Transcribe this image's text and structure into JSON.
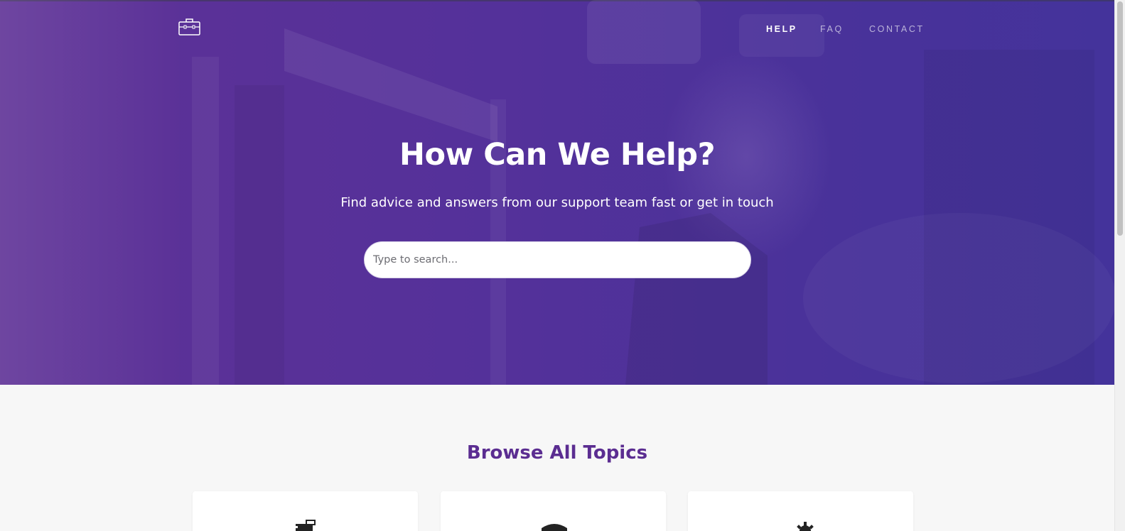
{
  "nav": {
    "logo": "briefcase-icon",
    "links": [
      {
        "label": "HELP",
        "active": true
      },
      {
        "label": "FAQ",
        "active": false
      },
      {
        "label": "CONTACT",
        "active": false
      }
    ]
  },
  "hero": {
    "title": "How Can We Help?",
    "subtitle": "Find advice and answers from our support team fast or get in touch",
    "search": {
      "placeholder": "Type to search...",
      "value": ""
    }
  },
  "topics": {
    "title": "Browse All Topics",
    "cards": [
      {
        "icon": "document-edit-icon"
      },
      {
        "icon": "graduation-cap-icon"
      },
      {
        "icon": "gear-icon"
      }
    ]
  },
  "colors": {
    "accent": "#5b2d91",
    "hero_left": "#5e3196",
    "hero_right": "#44339b",
    "section_bg": "#f7f7f7"
  }
}
